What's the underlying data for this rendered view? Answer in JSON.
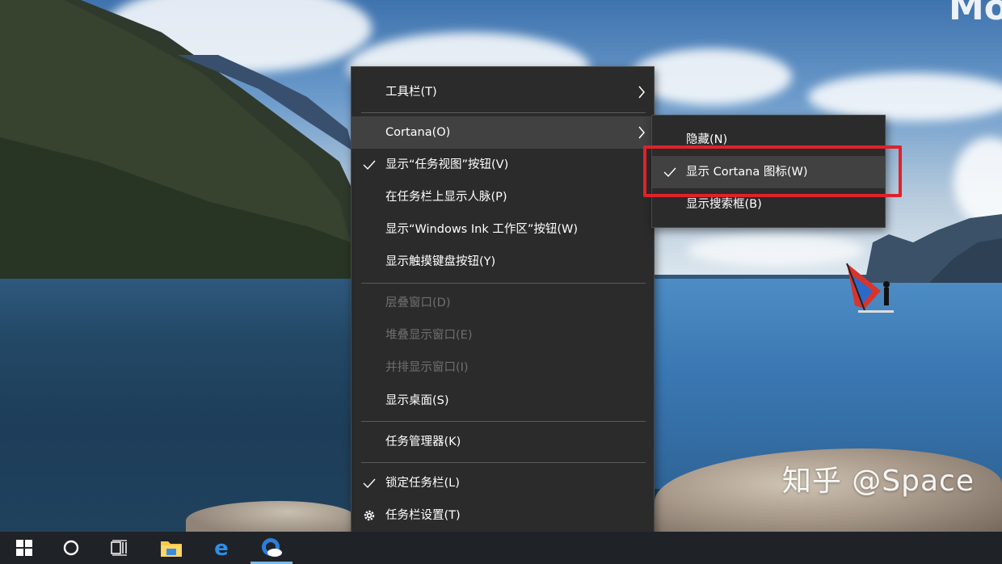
{
  "context_menu": {
    "items": [
      {
        "label": "工具栏(T)",
        "submenu": true
      },
      {
        "label": "Cortana(O)",
        "submenu": true
      },
      {
        "label": "显示“任务视图”按钮(V)",
        "checked": true
      },
      {
        "label": "在任务栏上显示人脉(P)"
      },
      {
        "label": "显示“Windows Ink 工作区”按钮(W)"
      },
      {
        "label": "显示触摸键盘按钮(Y)"
      },
      {
        "label": "层叠窗口(D)",
        "disabled": true
      },
      {
        "label": "堆叠显示窗口(E)",
        "disabled": true
      },
      {
        "label": "并排显示窗口(I)",
        "disabled": true
      },
      {
        "label": "显示桌面(S)"
      },
      {
        "label": "任务管理器(K)"
      },
      {
        "label": "锁定任务栏(L)",
        "checked": true
      },
      {
        "label": "任务栏设置(T)",
        "icon": "gear-icon"
      }
    ]
  },
  "cortana_submenu": {
    "items": [
      {
        "label": "隐藏(N)"
      },
      {
        "label": "显示 Cortana 图标(W)",
        "checked": true
      },
      {
        "label": "显示搜索框(B)"
      }
    ]
  },
  "taskbar": {
    "buttons": [
      "windows-start-icon",
      "cortana-icon",
      "task-view-icon",
      "file-explorer-icon",
      "edge-icon",
      "photos-app-icon"
    ]
  },
  "watermark": "知乎 @Space",
  "corner_text": "Mo",
  "colors": {
    "menu_bg": "#2b2b2b",
    "menu_hover": "#414141",
    "highlight": "#e0212b",
    "taskbar": "#1f2327"
  }
}
